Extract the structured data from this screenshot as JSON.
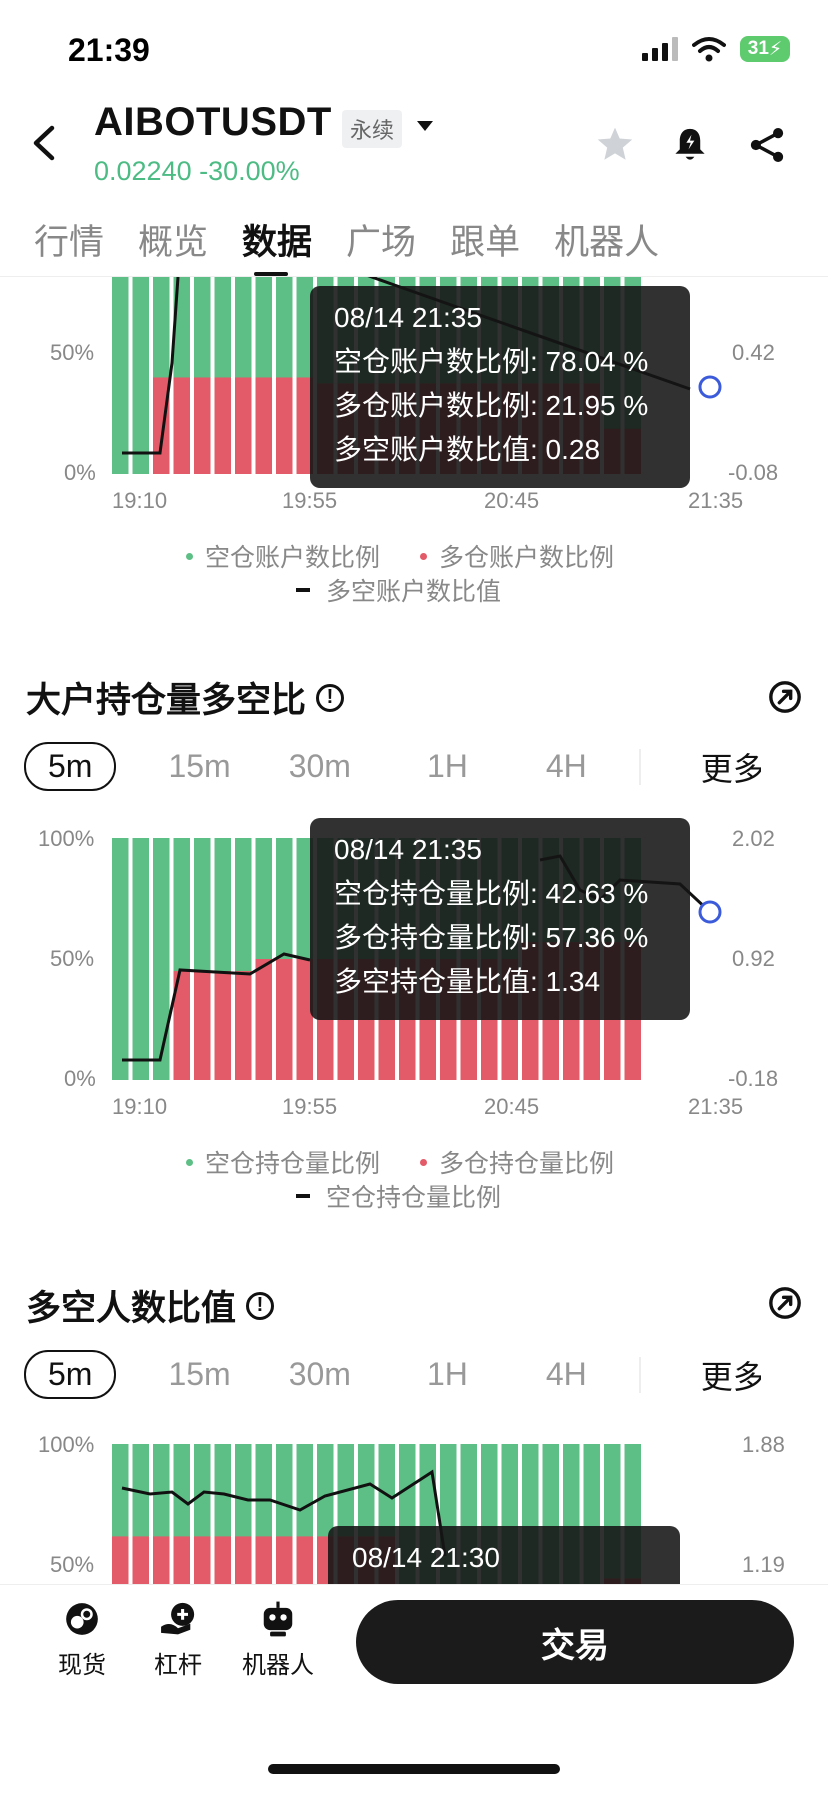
{
  "status": {
    "time": "21:39",
    "battery": "31"
  },
  "header": {
    "title": "AIBOTUSDT",
    "tag": "永续",
    "price": "0.02240 -30.00%"
  },
  "tabs": [
    "行情",
    "概览",
    "数据",
    "广场",
    "跟单",
    "机器人"
  ],
  "periods": [
    "5m",
    "15m",
    "30m",
    "1H",
    "4H",
    "更多"
  ],
  "chart1": {
    "y_left": [
      "50%",
      "0%"
    ],
    "y_right": [
      "0.42",
      "-0.08"
    ],
    "x_labels": [
      "19:10",
      "19:55",
      "20:45",
      "21:35"
    ],
    "tooltip": {
      "date": "08/14 21:35",
      "line1": "空仓账户数比例: 78.04 %",
      "line2": "多仓账户数比例: 21.95 %",
      "line3": "多空账户数比值: 0.28"
    },
    "legend": [
      "空仓账户数比例",
      "多仓账户数比例",
      "多空账户数比值"
    ]
  },
  "chart2": {
    "title": "大户持仓量多空比",
    "y_left": [
      "100%",
      "50%",
      "0%"
    ],
    "y_right": [
      "2.02",
      "0.92",
      "-0.18"
    ],
    "x_labels": [
      "19:10",
      "19:55",
      "20:45",
      "21:35"
    ],
    "tooltip": {
      "date": "08/14 21:35",
      "line1": "空仓持仓量比例: 42.63 %",
      "line2": "多仓持仓量比例: 57.36 %",
      "line3": "多空持仓量比值: 1.34"
    },
    "legend": [
      "空仓持仓量比例",
      "多仓持仓量比例",
      "空仓持仓量比例"
    ]
  },
  "chart3": {
    "title": "多空人数比值",
    "y_left": [
      "100%",
      "50%"
    ],
    "y_right": [
      "1.88",
      "1.19"
    ],
    "tooltip": {
      "date": "08/14 21:30"
    }
  },
  "bottom": {
    "spot": "现货",
    "margin": "杠杆",
    "bot": "机器人",
    "trade": "交易"
  },
  "colors": {
    "green": "#5dbf85",
    "red": "#e35b68",
    "price_green": "#4dbb84"
  }
}
